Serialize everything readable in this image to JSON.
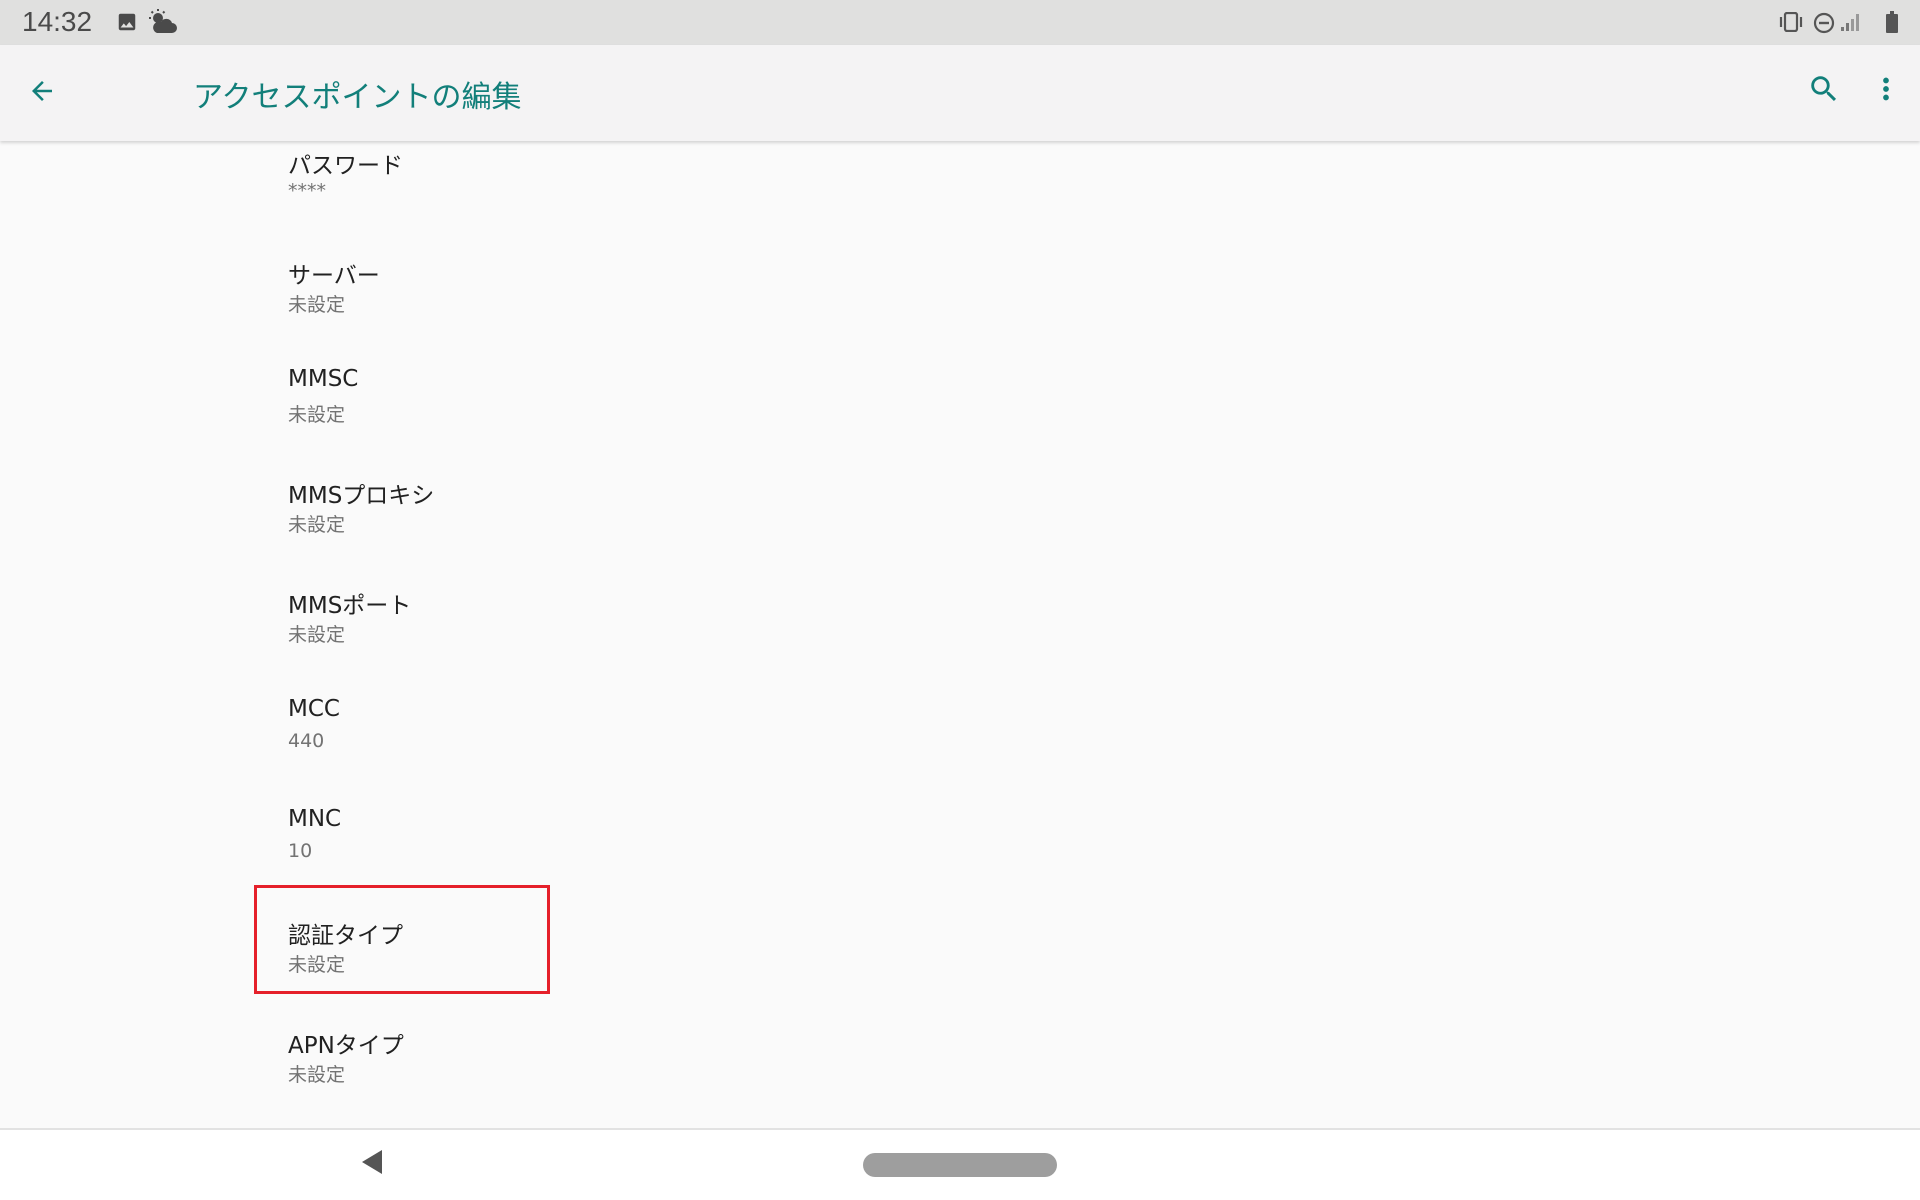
{
  "status_bar": {
    "time": "14:32",
    "left_icons": [
      "image-icon",
      "weather-icon"
    ],
    "right_icons": [
      "vibrate-icon",
      "dnd-icon",
      "signal-icon",
      "battery-icon"
    ]
  },
  "app_bar": {
    "title": "アクセスポイントの編集",
    "back_icon": "arrow-back-icon",
    "search_icon": "search-icon",
    "more_icon": "more-vert-icon",
    "accent_color": "#127f7a"
  },
  "preferences": [
    {
      "title": "パスワード",
      "summary": "****"
    },
    {
      "title": "サーバー",
      "summary": "未設定"
    },
    {
      "title": "MMSC",
      "summary": "未設定"
    },
    {
      "title": "MMSプロキシ",
      "summary": "未設定"
    },
    {
      "title": "MMSポート",
      "summary": "未設定"
    },
    {
      "title": "MCC",
      "summary": "440"
    },
    {
      "title": "MNC",
      "summary": "10"
    },
    {
      "title": "認証タイプ",
      "summary": "未設定"
    },
    {
      "title": "APNタイプ",
      "summary": "未設定"
    }
  ],
  "highlight": {
    "target": "認証タイプ",
    "color": "#e5202a"
  },
  "nav_bar": {
    "back_icon": "nav-back-triangle-icon",
    "home_icon": "home-pill-icon"
  }
}
